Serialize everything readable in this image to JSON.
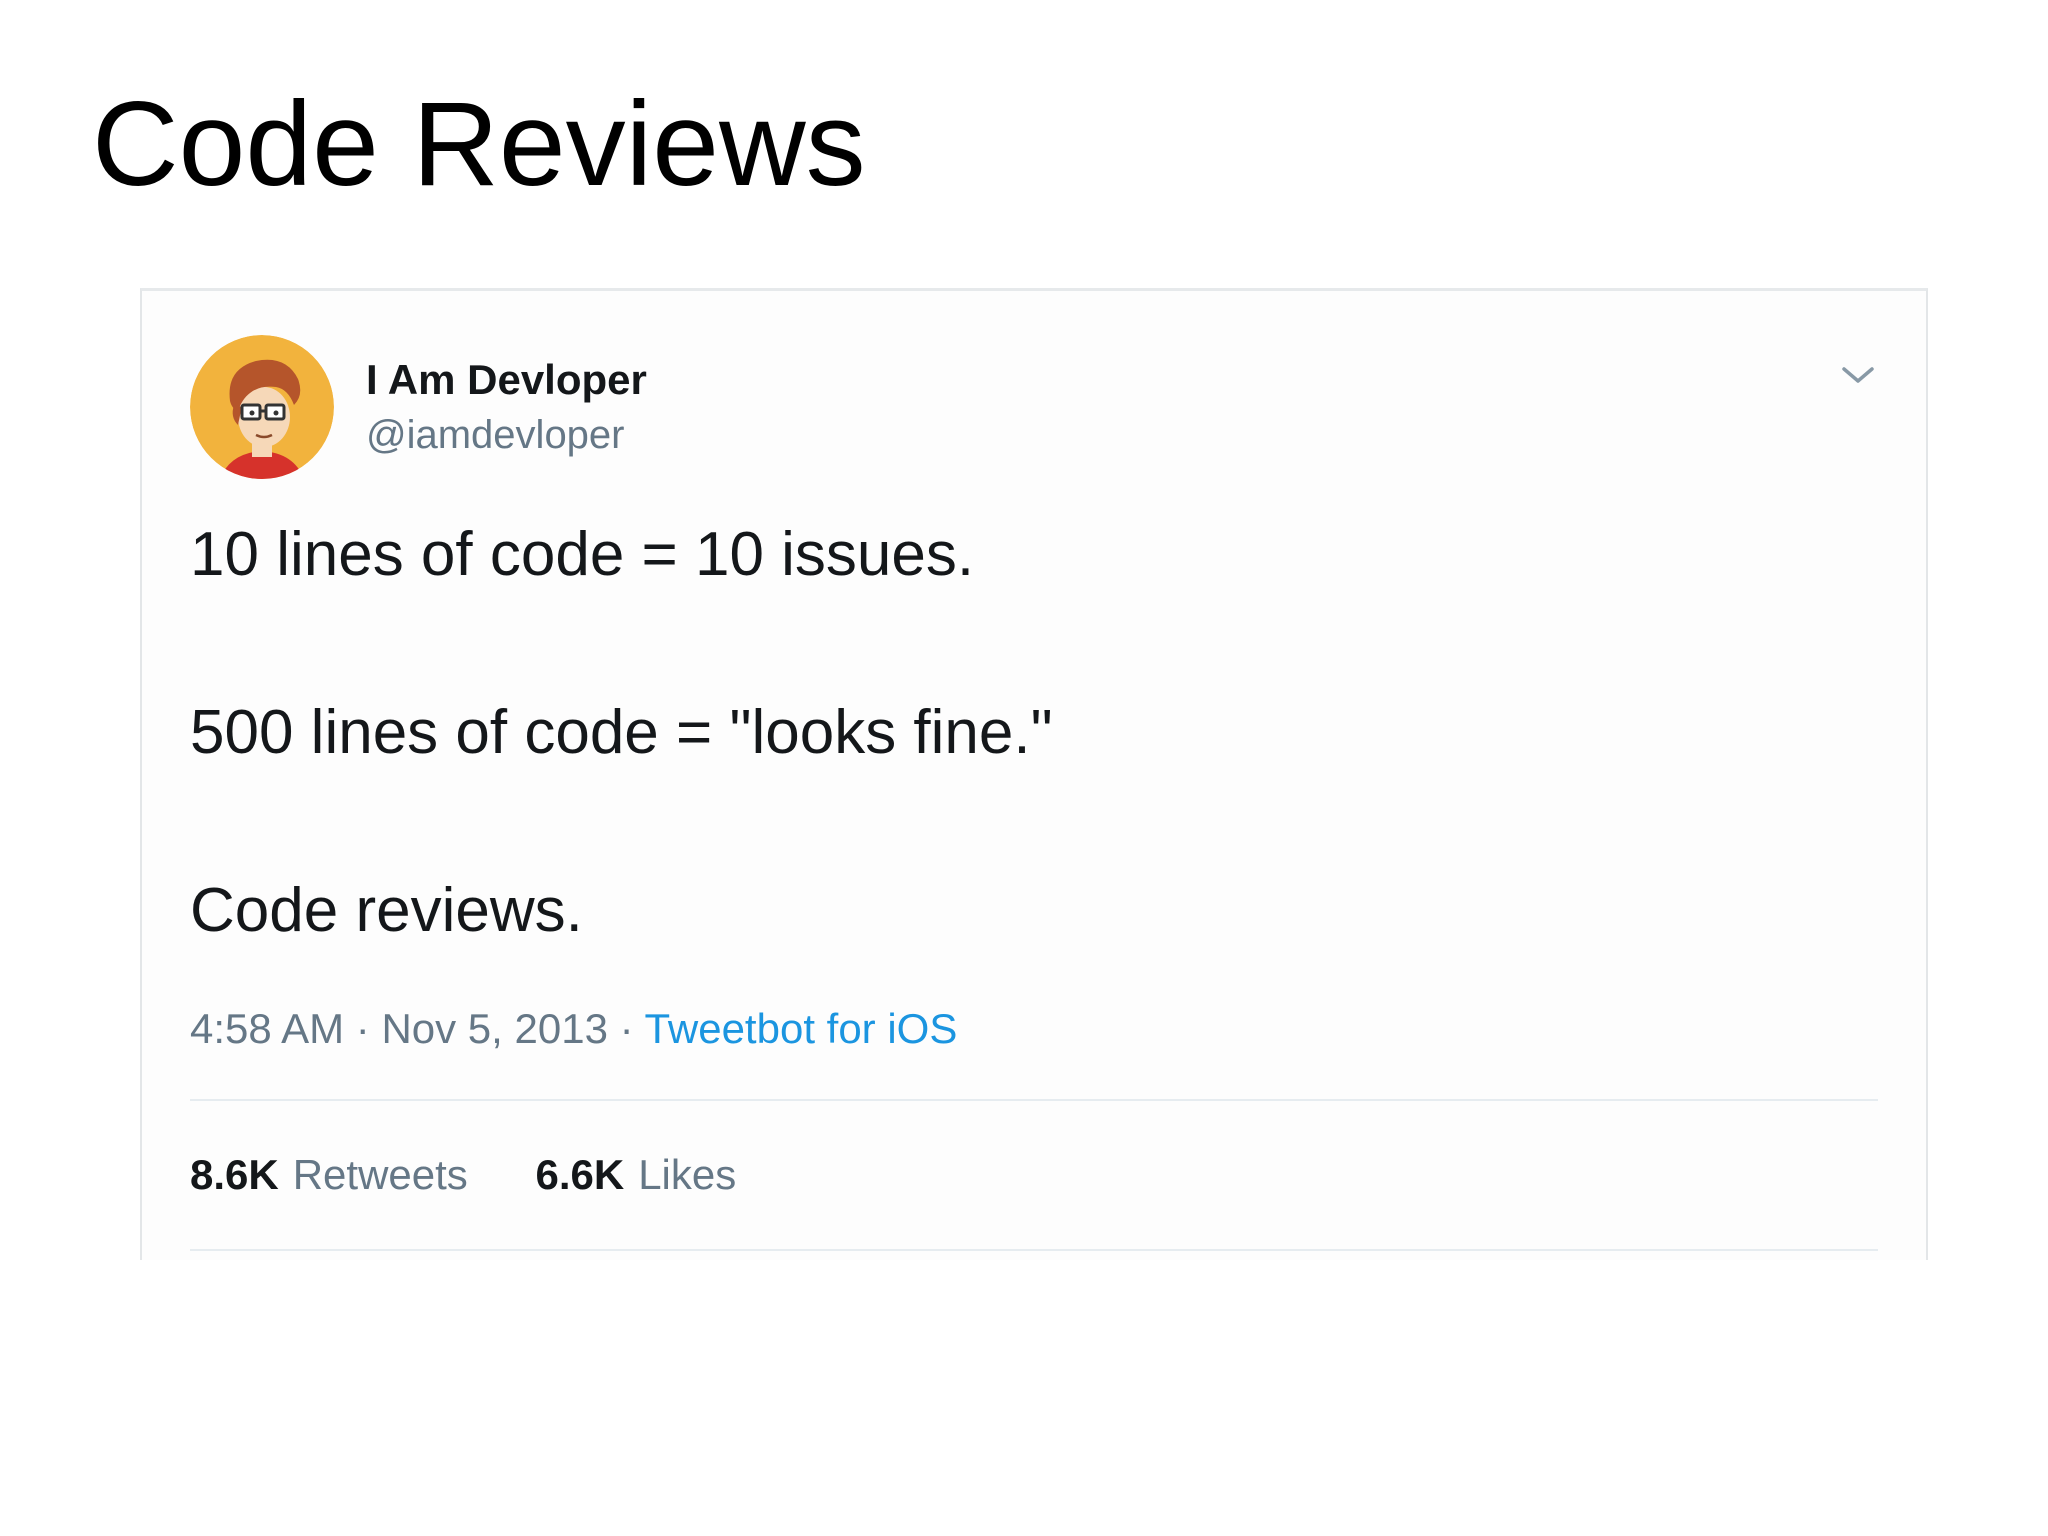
{
  "slide": {
    "title": "Code Reviews"
  },
  "tweet": {
    "author": {
      "name": "I Am Devloper",
      "handle": "@iamdevloper",
      "avatar_icon": "cartoon-developer-avatar-icon"
    },
    "menu_icon": "chevron-down-icon",
    "lines": [
      "10 lines of code = 10 issues.",
      "500 lines of code = \"looks fine.\"",
      "Code reviews."
    ],
    "meta": {
      "time": "4:58 AM",
      "separator": "·",
      "date": "Nov 5, 2013",
      "source": "Tweetbot for iOS"
    },
    "stats": {
      "retweets_count": "8.6K",
      "retweets_label": "Retweets",
      "likes_count": "6.6K",
      "likes_label": "Likes"
    }
  },
  "colors": {
    "text_primary": "#14171a",
    "text_secondary": "#657786",
    "link": "#1b95e0",
    "avatar_bg": "#f2b33d"
  }
}
